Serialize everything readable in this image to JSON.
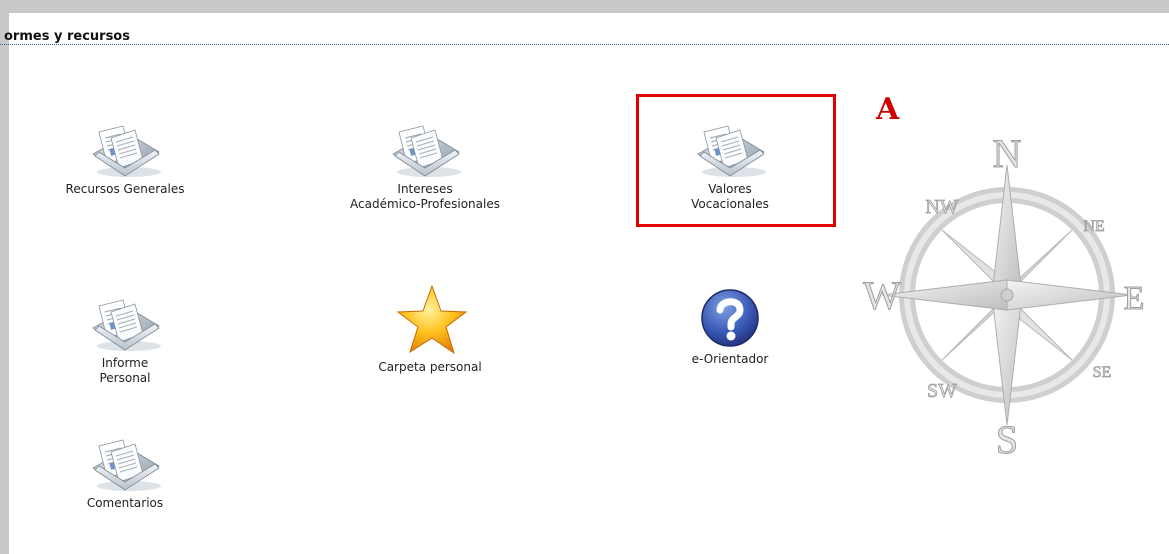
{
  "section": {
    "title": "ormes y recursos"
  },
  "items": [
    {
      "id": "recursos-generales",
      "label": "Recursos Generales",
      "icon": "folder-documents-icon"
    },
    {
      "id": "intereses",
      "label": "Intereses\nAcadémico-Profesionales",
      "icon": "folder-documents-icon"
    },
    {
      "id": "valores",
      "label": "Valores\nVocacionales",
      "icon": "folder-documents-icon"
    },
    {
      "id": "informe-personal",
      "label": "Informe\nPersonal",
      "icon": "folder-documents-icon"
    },
    {
      "id": "carpeta-personal",
      "label": "Carpeta personal",
      "icon": "star-icon"
    },
    {
      "id": "e-orientador",
      "label": "e-Orientador",
      "icon": "help-question-icon"
    },
    {
      "id": "comentarios",
      "label": "Comentarios",
      "icon": "folder-documents-icon"
    }
  ],
  "annotation": {
    "letter": "A",
    "color": "#e00000"
  },
  "compass": {
    "north": "N",
    "south": "S",
    "east": "E",
    "west": "W",
    "nw": "NW",
    "ne": "NE",
    "sw": "SW",
    "se": "SE"
  }
}
